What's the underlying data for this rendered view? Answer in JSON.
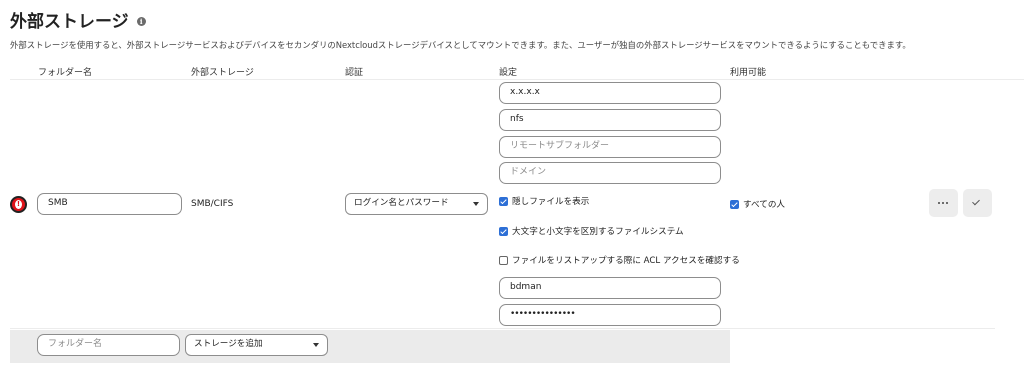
{
  "page": {
    "title": "外部ストレージ",
    "description": "外部ストレージを使用すると、外部ストレージサービスおよびデバイスをセカンダリのNextcloudストレージデバイスとしてマウントできます。また、ユーザーが独自の外部ストレージサービスをマウントできるようにすることもできます。"
  },
  "columns": {
    "folder": "フォルダー名",
    "storage": "外部ストレージ",
    "auth": "認証",
    "config": "設定",
    "available": "利用可能"
  },
  "mount": {
    "folder_name": "SMB",
    "storage_type": "SMB/CIFS",
    "auth_method": "ログイン名とパスワード",
    "config": {
      "host": "x.x.x.x",
      "share": "nfs",
      "remote_subfolder_placeholder": "リモートサブフォルダー",
      "domain_placeholder": "ドメイン",
      "show_hidden_label": "隠しファイルを表示",
      "show_hidden_checked": true,
      "case_sensitive_label": "大文字と小文字を区別するファイルシステム",
      "case_sensitive_checked": true,
      "check_acl_label": "ファイルをリストアップする際に ACL アクセスを確認する",
      "check_acl_checked": false,
      "username": "bdman",
      "password_mask": "•••••••••••••••"
    },
    "available_for_label": "すべての人",
    "available_for_checked": true
  },
  "add_row": {
    "folder_placeholder": "フォルダー名",
    "add_storage_label": "ストレージを追加"
  },
  "icons": {
    "info": "info-icon",
    "warning": "error-status-icon",
    "more": "more-actions-icon",
    "save": "checkmark-icon",
    "dropdown": "chevron-down-icon"
  },
  "colors": {
    "accent": "#2d6fd6",
    "error": "#e0141a"
  }
}
